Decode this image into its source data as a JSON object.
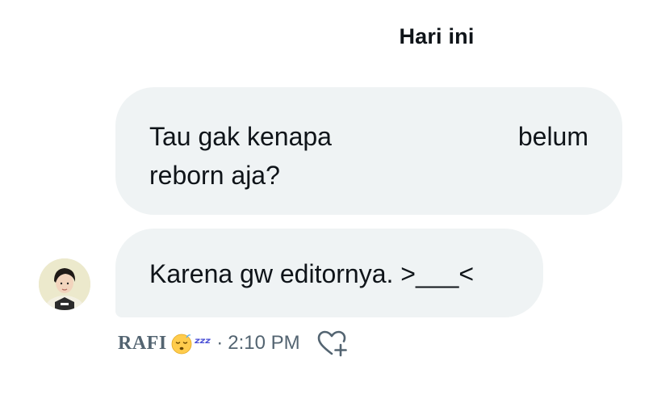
{
  "conversation": {
    "date_divider": "Hari ini"
  },
  "messages": [
    {
      "direction": "received",
      "line1_left": "Tau gak kenapa",
      "line1_right": "belum",
      "line2": "reborn aja?"
    },
    {
      "direction": "received",
      "text": "Karena gw editornya. >___<",
      "sender": "RAFI",
      "emoji": "sleeping-face",
      "zzz": "ᶻᶻᶻ",
      "separator": "·",
      "time": "2:10 PM",
      "reaction_icon": "heart-plus-icon"
    }
  ],
  "colors": {
    "bubble_background": "#eff3f4",
    "primary_text": "#0f1419",
    "secondary_text": "#536471"
  }
}
